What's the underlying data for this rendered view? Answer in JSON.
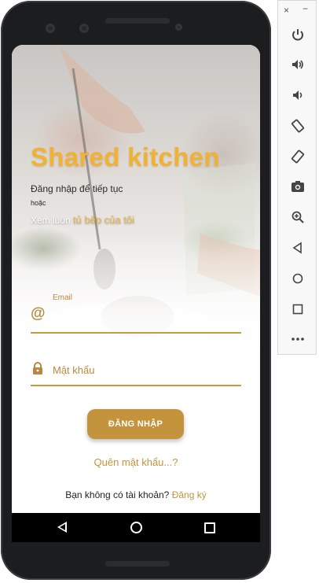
{
  "app": {
    "title": "Shared kitchen",
    "subtitle": "Đăng nhập để tiếp tục",
    "or_text": "hoặc",
    "browse_prefix": "Xem luôn ",
    "browse_link": "tủ bếp của tôi"
  },
  "login_form": {
    "email_label": "Email",
    "email_value": "",
    "password_placeholder": "Mật khẩu",
    "password_value": "",
    "login_button": "ĐĂNG NHẬP",
    "forgot_link": "Quên mật khẩu...?",
    "signup_prompt": "Bạn không có tài khoản?",
    "signup_link": "Đăng ký"
  },
  "colors": {
    "accent": "#c4943c",
    "title": "#f1b233"
  },
  "emulator_toolbar": {
    "close": "×",
    "minimize": "−",
    "icons": [
      "power-icon",
      "volume-up-icon",
      "volume-down-icon",
      "rotate-left-icon",
      "rotate-right-icon",
      "camera-icon",
      "zoom-icon",
      "back-icon",
      "home-icon",
      "overview-icon",
      "more-icon"
    ]
  },
  "nav_bar": {
    "icons": [
      "back-icon",
      "home-icon",
      "recents-icon"
    ]
  }
}
